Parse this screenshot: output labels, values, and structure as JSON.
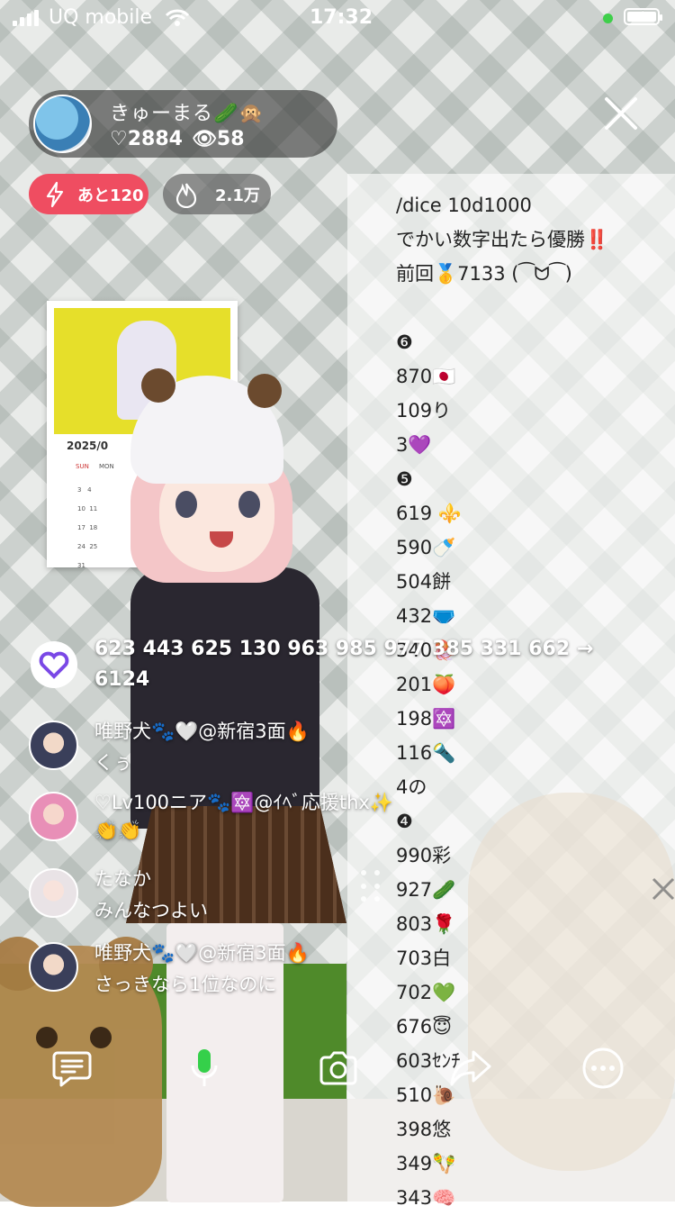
{
  "status_bar": {
    "carrier": "UQ mobile",
    "time": "17:32"
  },
  "host": {
    "name": "きゅーまる🥒🙊",
    "likes": "2884",
    "viewers": "58"
  },
  "badges": {
    "countdown": "あと120",
    "heat": "2.1万"
  },
  "calendar": {
    "year": "2025/0",
    "days": [
      "SUN",
      "MON"
    ],
    "rows": [
      "3   4",
      "10  11",
      "17  18",
      "24  25",
      "31"
    ]
  },
  "ticker": {
    "text": "623 443 625 130 963 985 977 385 331 662 → 6124"
  },
  "comments": [
    {
      "name": "唯野犬🐾🤍@新宿3面🔥",
      "body": "くぅ"
    },
    {
      "name": "♡Lv100ニア🐾🔯@ｲﾍﾞ応援thx✨",
      "body": "👏👏"
    },
    {
      "name": "たなか",
      "body": "みんなつよい"
    },
    {
      "name": "唯野犬🐾🤍@新宿3面🔥",
      "body": "さっきなら1位なのに"
    }
  ],
  "panel_lines": [
    "/dice 10d1000",
    "でかい数字出たら優勝‼️",
    "前回🥇7133 (⁀ᗢ⁀)",
    "",
    "❻",
    "870🇯🇵",
    "109り",
    "3💜",
    "❺",
    "619 ⚜️",
    "590🍼",
    "504餅",
    "432🩲",
    "340🪼",
    "201🍑",
    "198🔯",
    "116🔦",
    "4の",
    "❹",
    "990彩",
    "927🥒",
    "803🌹",
    "703白",
    "702💚",
    "676😇",
    "603ｾﾝﾁ",
    "510🐌",
    "398悠",
    "349🪇",
    "343🧠"
  ],
  "colors": {
    "accent_red": "#ef4d61",
    "live_dot": "#3ecf4a",
    "mic_green": "#35d04a"
  }
}
